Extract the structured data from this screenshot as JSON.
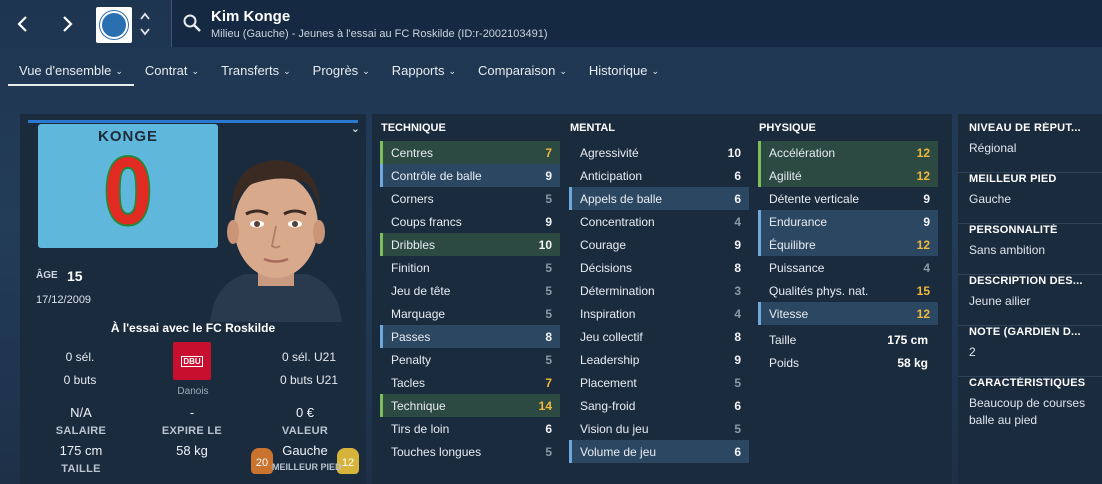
{
  "nav": {
    "back_icon": "chevron-left-icon",
    "forward_icon": "chevron-right-icon",
    "updown_icon": "updown-chevrons-icon"
  },
  "player": {
    "name": "Kim Konge",
    "subtitle": "Milieu (Gauche) - Jeunes à l'essai au FC Roskilde (ID:r-2002103491)"
  },
  "tabs": [
    {
      "label": "Vue d'ensemble",
      "active": true
    },
    {
      "label": "Contrat"
    },
    {
      "label": "Transferts"
    },
    {
      "label": "Progrès"
    },
    {
      "label": "Rapports"
    },
    {
      "label": "Comparaison"
    },
    {
      "label": "Historique"
    }
  ],
  "card": {
    "shirt_name": "KONGE",
    "shirt_number": "0",
    "age_label": "ÂGE",
    "age": "15",
    "dob": "17/12/2009",
    "trial_text": "À l'essai avec le FC Roskilde",
    "caps_senior": "0 sél.",
    "goals_senior": "0 buts",
    "caps_u21": "0 sél. U21",
    "goals_u21": "0 buts U21",
    "flag_text": "DBU",
    "nationality": "Danois",
    "salary_value": "N/A",
    "salary_label": "SALAIRE",
    "expires_value": "-",
    "expires_label": "EXPIRE LE",
    "value_value": "0 €",
    "value_label": "VALEUR",
    "height_value": "175 cm",
    "height_label": "TAILLE",
    "weight_value": "58 kg",
    "foot_value": "Gauche",
    "foot_label": "MEILLEUR PIED",
    "left_foot_rating": "20",
    "right_foot_rating": "12"
  },
  "attributes": {
    "technique": {
      "title": "TECHNIQUE",
      "rows": [
        {
          "label": "Centres",
          "value": "7",
          "hl": "green",
          "tone": "gold"
        },
        {
          "label": "Contrôle de balle",
          "value": "9",
          "hl": "blue",
          "tone": "white"
        },
        {
          "label": "Corners",
          "value": "5",
          "hl": "",
          "tone": "grey"
        },
        {
          "label": "Coups francs",
          "value": "9",
          "hl": "",
          "tone": "white"
        },
        {
          "label": "Dribbles",
          "value": "10",
          "hl": "green",
          "tone": "white"
        },
        {
          "label": "Finition",
          "value": "5",
          "hl": "",
          "tone": "grey"
        },
        {
          "label": "Jeu de tête",
          "value": "5",
          "hl": "",
          "tone": "grey"
        },
        {
          "label": "Marquage",
          "value": "5",
          "hl": "",
          "tone": "grey"
        },
        {
          "label": "Passes",
          "value": "8",
          "hl": "blue",
          "tone": "white"
        },
        {
          "label": "Penalty",
          "value": "5",
          "hl": "",
          "tone": "grey"
        },
        {
          "label": "Tacles",
          "value": "7",
          "hl": "",
          "tone": "gold"
        },
        {
          "label": "Technique",
          "value": "14",
          "hl": "green",
          "tone": "gold"
        },
        {
          "label": "Tirs de loin",
          "value": "6",
          "hl": "",
          "tone": "white"
        },
        {
          "label": "Touches longues",
          "value": "5",
          "hl": "",
          "tone": "grey"
        }
      ]
    },
    "mental": {
      "title": "MENTAL",
      "rows": [
        {
          "label": "Agressivité",
          "value": "10",
          "hl": "",
          "tone": "white"
        },
        {
          "label": "Anticipation",
          "value": "6",
          "hl": "",
          "tone": "white"
        },
        {
          "label": "Appels de balle",
          "value": "6",
          "hl": "blue",
          "tone": "white"
        },
        {
          "label": "Concentration",
          "value": "4",
          "hl": "",
          "tone": "grey"
        },
        {
          "label": "Courage",
          "value": "9",
          "hl": "",
          "tone": "white"
        },
        {
          "label": "Décisions",
          "value": "8",
          "hl": "",
          "tone": "white"
        },
        {
          "label": "Détermination",
          "value": "3",
          "hl": "",
          "tone": "grey"
        },
        {
          "label": "Inspiration",
          "value": "4",
          "hl": "",
          "tone": "grey"
        },
        {
          "label": "Jeu collectif",
          "value": "8",
          "hl": "",
          "tone": "white"
        },
        {
          "label": "Leadership",
          "value": "9",
          "hl": "",
          "tone": "white"
        },
        {
          "label": "Placement",
          "value": "5",
          "hl": "",
          "tone": "grey"
        },
        {
          "label": "Sang-froid",
          "value": "6",
          "hl": "",
          "tone": "white"
        },
        {
          "label": "Vision du jeu",
          "value": "5",
          "hl": "",
          "tone": "grey"
        },
        {
          "label": "Volume de jeu",
          "value": "6",
          "hl": "blue",
          "tone": "white"
        }
      ]
    },
    "physique": {
      "title": "PHYSIQUE",
      "rows": [
        {
          "label": "Accélération",
          "value": "12",
          "hl": "green",
          "tone": "gold"
        },
        {
          "label": "Agilité",
          "value": "12",
          "hl": "green",
          "tone": "gold"
        },
        {
          "label": "Détente verticale",
          "value": "9",
          "hl": "",
          "tone": "white"
        },
        {
          "label": "Endurance",
          "value": "9",
          "hl": "blue",
          "tone": "white"
        },
        {
          "label": "Équilibre",
          "value": "12",
          "hl": "blue",
          "tone": "gold"
        },
        {
          "label": "Puissance",
          "value": "4",
          "hl": "",
          "tone": "grey"
        },
        {
          "label": "Qualités phys. nat.",
          "value": "15",
          "hl": "",
          "tone": "gold"
        },
        {
          "label": "Vitesse",
          "value": "12",
          "hl": "blue",
          "tone": "gold"
        }
      ],
      "height_label": "Taille",
      "height_value": "175 cm",
      "weight_label": "Poids",
      "weight_value": "58 kg"
    }
  },
  "info": [
    {
      "title": "NIVEAU DE RÉPUT...",
      "value": "Régional"
    },
    {
      "title": "MEILLEUR PIED",
      "value": "Gauche"
    },
    {
      "title": "PERSONNALITÉ",
      "value": "Sans ambition"
    },
    {
      "title": "DESCRIPTION DES...",
      "value": "Jeune ailier"
    },
    {
      "title": "NOTE (GARDIEN D...",
      "value": "2"
    },
    {
      "title": "CARACTÉRISTIQUES",
      "value": "Beaucoup de courses balle au pied"
    }
  ],
  "colors": {
    "highlight_green": "#2c4a42",
    "highlight_blue": "#2c4762",
    "value_gold": "#f0b93c",
    "value_grey": "#8b98a6",
    "accent_blue": "#2a78d0",
    "shirt": "#5fb8dc"
  }
}
